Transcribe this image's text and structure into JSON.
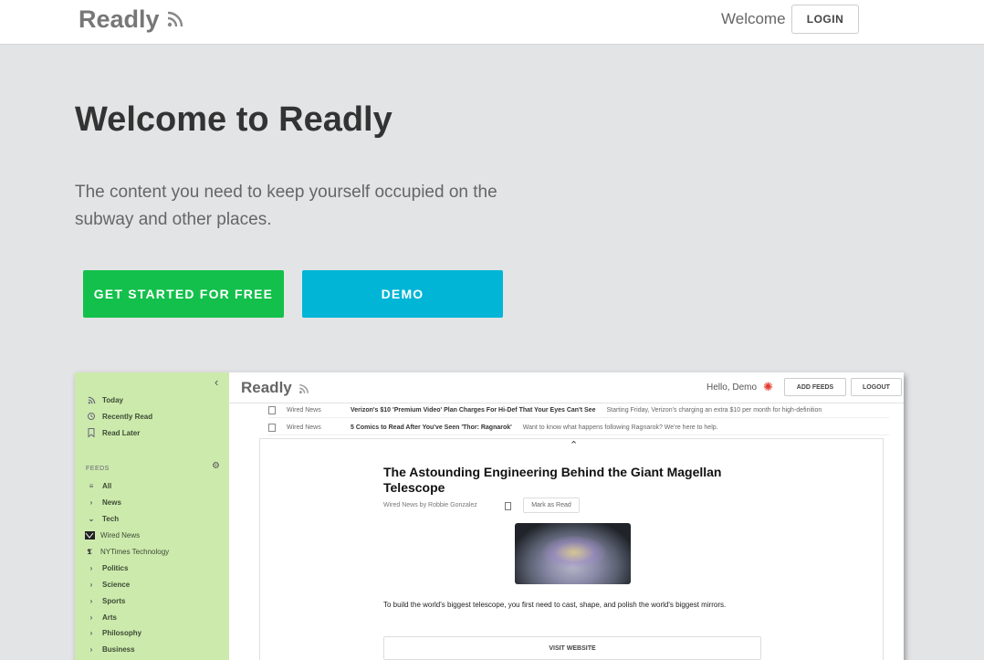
{
  "nav": {
    "brand": "Readly",
    "welcome": "Welcome",
    "login_label": "LOGIN"
  },
  "hero": {
    "title": "Welcome to Readly",
    "subtitle": "The content you need to keep yourself occupied on the subway and other places.",
    "start_label": "GET STARTED FOR FREE",
    "demo_label": "DEMO"
  },
  "colors": {
    "start_button": "#13c04b",
    "demo_button": "#00b5d6",
    "sidebar": "#cdeaad",
    "page_bg": "#e3e4e6"
  },
  "preview": {
    "brand": "Readly",
    "hello": "Hello, Demo",
    "add_feeds_label": "ADD FEEDS",
    "logout_label": "LOGOUT",
    "sidebar": {
      "top_items": [
        {
          "label": "Today",
          "icon": "rss-icon"
        },
        {
          "label": "Recently Read",
          "icon": "history-icon"
        },
        {
          "label": "Read Later",
          "icon": "bookmark-icon"
        }
      ],
      "feeds_label": "FEEDS",
      "feeds": [
        {
          "label": "All",
          "icon": "list-icon"
        },
        {
          "label": "News",
          "icon": "chevron-right-icon"
        },
        {
          "label": "Tech",
          "icon": "chevron-down-icon"
        },
        {
          "label": "Wired News",
          "icon": "wired-logo-icon"
        },
        {
          "label": "NYTimes Technology",
          "icon": "nytimes-logo-icon"
        },
        {
          "label": "Politics",
          "icon": "chevron-right-icon"
        },
        {
          "label": "Science",
          "icon": "chevron-right-icon"
        },
        {
          "label": "Sports",
          "icon": "chevron-right-icon"
        },
        {
          "label": "Arts",
          "icon": "chevron-right-icon"
        },
        {
          "label": "Philosophy",
          "icon": "chevron-right-icon"
        },
        {
          "label": "Business",
          "icon": "chevron-right-icon"
        }
      ]
    },
    "rows": [
      {
        "source": "Wired News",
        "title": "Verizon's $10 'Premium Video' Plan Charges For Hi-Def That Your Eyes Can't See",
        "snippet": "Starting Friday, Verizon's charging an extra $10 per month for high-definition"
      },
      {
        "source": "Wired News",
        "title": "5 Comics to Read After You've Seen 'Thor: Ragnarok'",
        "snippet": "Want to know what happens following Ragnarok? We're here to help."
      }
    ],
    "article": {
      "title": "The Astounding Engineering Behind the Giant Magellan Telescope",
      "byline": "Wired News by Robbie Gonzalez",
      "mark_read_label": "Mark as Read",
      "body": "To build the world's biggest telescope, you first need to cast, shape, and polish the world's biggest mirrors.",
      "visit_label": "VISIT WEBSITE"
    }
  }
}
